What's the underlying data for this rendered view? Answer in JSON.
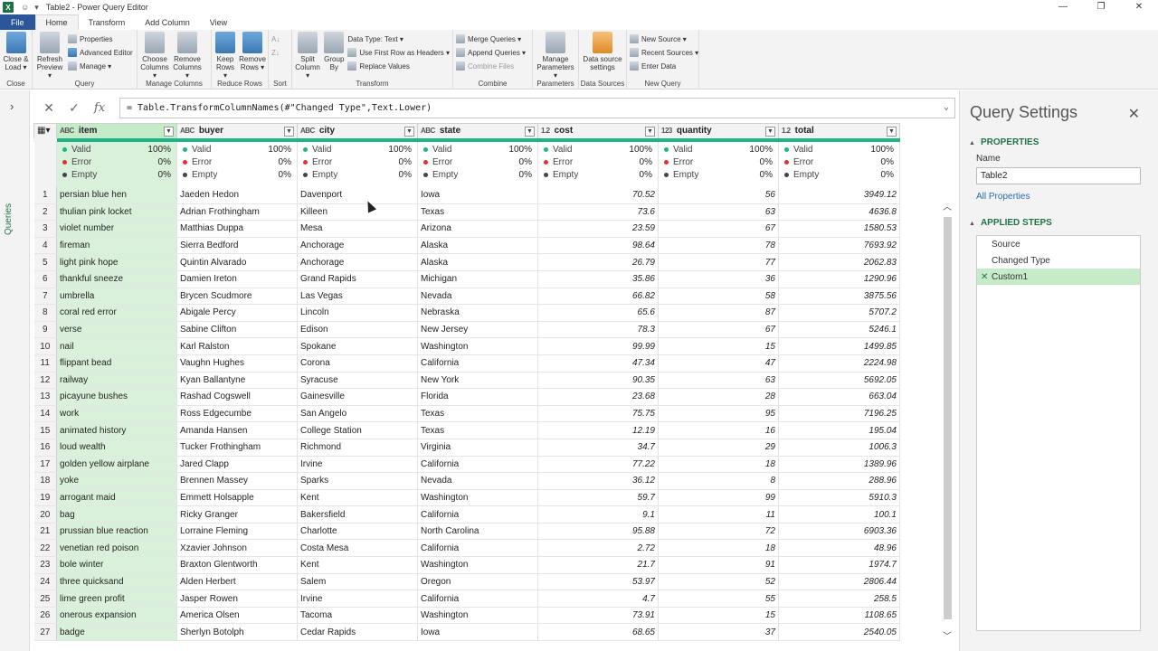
{
  "window": {
    "title": "Table2 - Power Query Editor",
    "app_icon": "X",
    "minimize": "—",
    "restore": "❐",
    "close": "✕"
  },
  "ribbon_tabs": [
    "File",
    "Home",
    "Transform",
    "Add Column",
    "View"
  ],
  "ribbon": {
    "close_group": {
      "label": "Close",
      "close_load": "Close & Load ▾"
    },
    "query_group": {
      "label": "Query",
      "refresh": "Refresh Preview ▾",
      "properties": "Properties",
      "advanced_editor": "Advanced Editor",
      "manage": "Manage ▾"
    },
    "manage_columns": {
      "label": "Manage Columns",
      "choose": "Choose Columns ▾",
      "remove": "Remove Columns ▾"
    },
    "reduce_rows": {
      "label": "Reduce Rows",
      "keep": "Keep Rows ▾",
      "remove": "Remove Rows ▾"
    },
    "sort": {
      "label": "Sort"
    },
    "transform": {
      "label": "Transform",
      "split": "Split Column ▾",
      "group_by": "Group By",
      "data_type": "Data Type: Text ▾",
      "first_row": "Use First Row as Headers ▾",
      "replace": "Replace Values"
    },
    "combine": {
      "label": "Combine",
      "merge": "Merge Queries ▾",
      "append": "Append Queries ▾",
      "files": "Combine Files"
    },
    "parameters": {
      "label": "Parameters",
      "manage": "Manage Parameters ▾"
    },
    "data_sources": {
      "label": "Data Sources",
      "settings": "Data source settings"
    },
    "new_query": {
      "label": "New Query",
      "new_source": "New Source ▾",
      "recent": "Recent Sources ▾",
      "enter_data": "Enter Data"
    }
  },
  "queries_pane": {
    "label": "Queries"
  },
  "formula": {
    "text": "= Table.TransformColumnNames(#\"Changed Type\",Text.Lower)",
    "cancel": "✕",
    "commit": "✓",
    "fx": "fx"
  },
  "columns": [
    {
      "name": "item",
      "type": "ABC"
    },
    {
      "name": "buyer",
      "type": "ABC"
    },
    {
      "name": "city",
      "type": "ABC"
    },
    {
      "name": "state",
      "type": "ABC"
    },
    {
      "name": "cost",
      "type": "1.2"
    },
    {
      "name": "quantity",
      "type": "123"
    },
    {
      "name": "total",
      "type": "1.2"
    }
  ],
  "quality": {
    "labels": [
      "Valid",
      "Error",
      "Empty"
    ],
    "values": [
      "100%",
      "0%",
      "0%"
    ]
  },
  "rows": [
    [
      "persian blue hen",
      "Jaeden Hedon",
      "Davenport",
      "Iowa",
      "70.52",
      "56",
      "3949.12"
    ],
    [
      "thulian pink locket",
      "Adrian Frothingham",
      "Killeen",
      "Texas",
      "73.6",
      "63",
      "4636.8"
    ],
    [
      "violet number",
      "Matthias Duppa",
      "Mesa",
      "Arizona",
      "23.59",
      "67",
      "1580.53"
    ],
    [
      "fireman",
      "Sierra Bedford",
      "Anchorage",
      "Alaska",
      "98.64",
      "78",
      "7693.92"
    ],
    [
      "light pink hope",
      "Quintin Alvarado",
      "Anchorage",
      "Alaska",
      "26.79",
      "77",
      "2062.83"
    ],
    [
      "thankful sneeze",
      "Damien Ireton",
      "Grand Rapids",
      "Michigan",
      "35.86",
      "36",
      "1290.96"
    ],
    [
      "umbrella",
      "Brycen Scudmore",
      "Las Vegas",
      "Nevada",
      "66.82",
      "58",
      "3875.56"
    ],
    [
      "coral red error",
      "Abigale Percy",
      "Lincoln",
      "Nebraska",
      "65.6",
      "87",
      "5707.2"
    ],
    [
      "verse",
      "Sabine Clifton",
      "Edison",
      "New Jersey",
      "78.3",
      "67",
      "5246.1"
    ],
    [
      "nail",
      "Karl Ralston",
      "Spokane",
      "Washington",
      "99.99",
      "15",
      "1499.85"
    ],
    [
      "flippant bead",
      "Vaughn Hughes",
      "Corona",
      "California",
      "47.34",
      "47",
      "2224.98"
    ],
    [
      "railway",
      "Kyan Ballantyne",
      "Syracuse",
      "New York",
      "90.35",
      "63",
      "5692.05"
    ],
    [
      "picayune bushes",
      "Rashad Cogswell",
      "Gainesville",
      "Florida",
      "23.68",
      "28",
      "663.04"
    ],
    [
      "work",
      "Ross Edgecumbe",
      "San Angelo",
      "Texas",
      "75.75",
      "95",
      "7196.25"
    ],
    [
      "animated history",
      "Amanda Hansen",
      "College Station",
      "Texas",
      "12.19",
      "16",
      "195.04"
    ],
    [
      "loud wealth",
      "Tucker Frothingham",
      "Richmond",
      "Virginia",
      "34.7",
      "29",
      "1006.3"
    ],
    [
      "golden yellow airplane",
      "Jared Clapp",
      "Irvine",
      "California",
      "77.22",
      "18",
      "1389.96"
    ],
    [
      "yoke",
      "Brennen Massey",
      "Sparks",
      "Nevada",
      "36.12",
      "8",
      "288.96"
    ],
    [
      "arrogant maid",
      "Emmett Holsapple",
      "Kent",
      "Washington",
      "59.7",
      "99",
      "5910.3"
    ],
    [
      "bag",
      "Ricky Granger",
      "Bakersfield",
      "California",
      "9.1",
      "11",
      "100.1"
    ],
    [
      "prussian blue reaction",
      "Lorraine Fleming",
      "Charlotte",
      "North Carolina",
      "95.88",
      "72",
      "6903.36"
    ],
    [
      "venetian red poison",
      "Xzavier Johnson",
      "Costa Mesa",
      "California",
      "2.72",
      "18",
      "48.96"
    ],
    [
      "bole winter",
      "Braxton Glentworth",
      "Kent",
      "Washington",
      "21.7",
      "91",
      "1974.7"
    ],
    [
      "three quicksand",
      "Alden Herbert",
      "Salem",
      "Oregon",
      "53.97",
      "52",
      "2806.44"
    ],
    [
      "lime green profit",
      "Jasper Rowen",
      "Irvine",
      "California",
      "4.7",
      "55",
      "258.5"
    ],
    [
      "onerous expansion",
      "America Olsen",
      "Tacoma",
      "Washington",
      "73.91",
      "15",
      "1108.65"
    ],
    [
      "badge",
      "Sherlyn Botolph",
      "Cedar Rapids",
      "Iowa",
      "68.65",
      "37",
      "2540.05"
    ]
  ],
  "settings": {
    "title": "Query Settings",
    "close": "✕",
    "properties_header": "PROPERTIES",
    "name_label": "Name",
    "name_value": "Table2",
    "all_properties": "All Properties",
    "steps_header": "APPLIED STEPS",
    "steps": [
      "Source",
      "Changed Type",
      "Custom1"
    ],
    "selected_step": "Custom1"
  },
  "colors": {
    "accent": "#217346",
    "valid": "#1fb388",
    "error": "#e03131",
    "selected": "#c6ebc9"
  }
}
